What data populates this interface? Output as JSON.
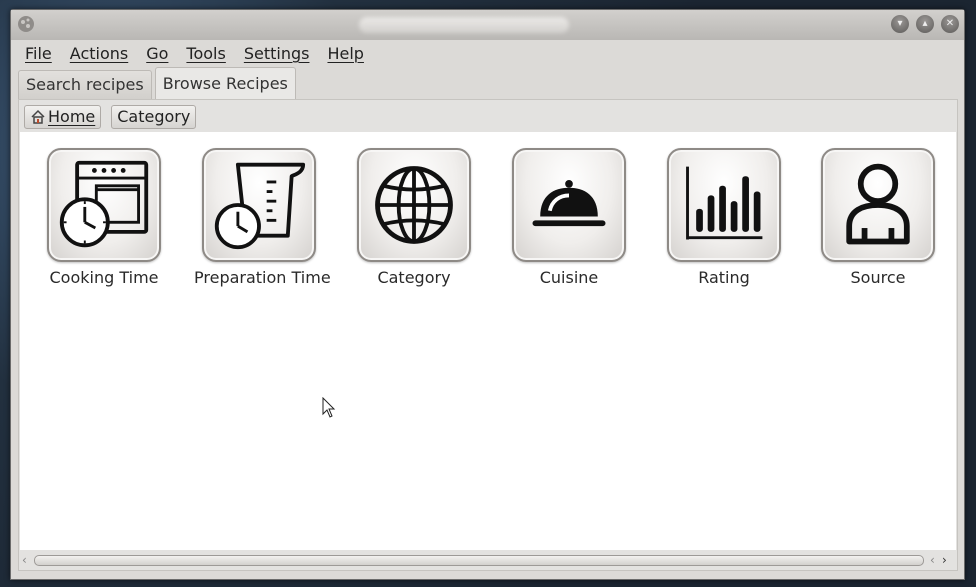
{
  "menubar": {
    "items": [
      {
        "label": "File"
      },
      {
        "label": "Actions"
      },
      {
        "label": "Go"
      },
      {
        "label": "Tools"
      },
      {
        "label": "Settings"
      },
      {
        "label": "Help"
      }
    ]
  },
  "tabs": [
    {
      "label": "Search recipes",
      "active": false
    },
    {
      "label": "Browse Recipes",
      "active": true
    }
  ],
  "breadcrumb": {
    "home_label": "Home",
    "home_icon": "home-icon",
    "category_label": "Category"
  },
  "browse_tiles": [
    {
      "label": "Cooking Time",
      "icon": "oven-clock-icon"
    },
    {
      "label": "Preparation Time",
      "icon": "measuring-cup-clock-icon"
    },
    {
      "label": "Category",
      "icon": "globe-icon"
    },
    {
      "label": "Cuisine",
      "icon": "cloche-icon"
    },
    {
      "label": "Rating",
      "icon": "bar-chart-icon"
    },
    {
      "label": "Source",
      "icon": "person-icon"
    }
  ],
  "window_controls": {
    "minimize_icon": "minimize-icon",
    "maximize_icon": "maximize-icon",
    "close_icon": "close-icon"
  }
}
